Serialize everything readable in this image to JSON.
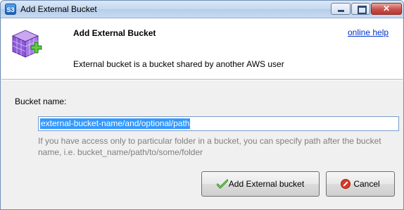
{
  "window": {
    "app_icon_text": "S3",
    "title": "Add External Bucket",
    "controls": {
      "close_glyph": "✕"
    }
  },
  "header": {
    "title": "Add External Bucket",
    "subtitle": "External bucket is a bucket shared by another AWS user",
    "help_link": "online help",
    "icon": "purple-cube-add-icon"
  },
  "form": {
    "bucket_label": "Bucket name:",
    "bucket_value": "external-bucket-name/and/optional/path",
    "hint": "If you have access only to particular folder in a bucket, you can specify path after the bucket name, i.e. bucket_name/path/to/some/folder"
  },
  "buttons": {
    "add_label": "Add External bucket",
    "cancel_label": "Cancel"
  },
  "colors": {
    "link": "#0033cc",
    "selection": "#3399ff",
    "hint_text": "#808080",
    "cancel_icon": "#d83a2a"
  }
}
